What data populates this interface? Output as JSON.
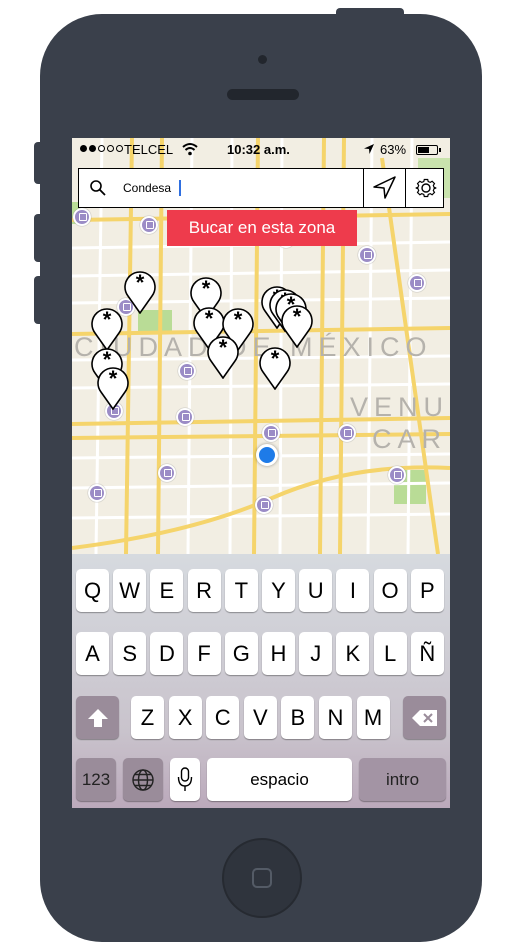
{
  "status_bar": {
    "carrier": "TELCEL",
    "time": "10:32 a.m.",
    "battery": "63%",
    "battery_level": 0.63,
    "signal_bars_filled": 2,
    "signal_bars_total": 5
  },
  "search": {
    "value": "Condesa",
    "placeholder": "",
    "icon": "search-icon"
  },
  "toolbar": {
    "navigate_icon": "navigation-arrow-icon",
    "settings_icon": "gear-icon"
  },
  "map": {
    "zone_button_label": "Bucar en esta zona",
    "labels": {
      "city": "CIUDAD DE MÉXICO",
      "venu": "VENU",
      "car": "CAR"
    },
    "pin_symbol": "*",
    "colors": {
      "zone_button": "#ee3b4c",
      "user_location": "#1e7be8",
      "metro_marker": "#9b8cc6",
      "road_major": "#f5d46b",
      "park": "#b9dc96"
    }
  },
  "keyboard": {
    "row1": [
      "Q",
      "W",
      "E",
      "R",
      "T",
      "Y",
      "U",
      "I",
      "O",
      "P"
    ],
    "row2": [
      "A",
      "S",
      "D",
      "F",
      "G",
      "H",
      "J",
      "K",
      "L",
      "Ñ"
    ],
    "row3": [
      "Z",
      "X",
      "C",
      "V",
      "B",
      "N",
      "M"
    ],
    "numbers_key": "123",
    "space_key": "espacio",
    "return_key": "intro",
    "shift_icon": "shift-arrow-icon",
    "delete_icon": "backspace-icon",
    "globe_icon": "globe-icon",
    "mic_icon": "microphone-icon"
  }
}
